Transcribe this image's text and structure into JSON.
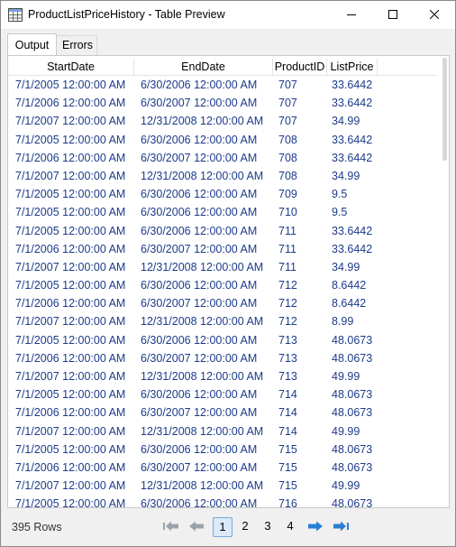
{
  "window": {
    "title": "ProductListPriceHistory - Table Preview"
  },
  "tabs": [
    {
      "label": "Output"
    },
    {
      "label": "Errors"
    }
  ],
  "table": {
    "columns": [
      "StartDate",
      "EndDate",
      "ProductID",
      "ListPrice"
    ],
    "rows": [
      [
        "7/1/2005 12:00:00 AM",
        "6/30/2006 12:00:00 AM",
        "707",
        "33.6442"
      ],
      [
        "7/1/2006 12:00:00 AM",
        "6/30/2007 12:00:00 AM",
        "707",
        "33.6442"
      ],
      [
        "7/1/2007 12:00:00 AM",
        "12/31/2008 12:00:00 AM",
        "707",
        "34.99"
      ],
      [
        "7/1/2005 12:00:00 AM",
        "6/30/2006 12:00:00 AM",
        "708",
        "33.6442"
      ],
      [
        "7/1/2006 12:00:00 AM",
        "6/30/2007 12:00:00 AM",
        "708",
        "33.6442"
      ],
      [
        "7/1/2007 12:00:00 AM",
        "12/31/2008 12:00:00 AM",
        "708",
        "34.99"
      ],
      [
        "7/1/2005 12:00:00 AM",
        "6/30/2006 12:00:00 AM",
        "709",
        "9.5"
      ],
      [
        "7/1/2005 12:00:00 AM",
        "6/30/2006 12:00:00 AM",
        "710",
        "9.5"
      ],
      [
        "7/1/2005 12:00:00 AM",
        "6/30/2006 12:00:00 AM",
        "711",
        "33.6442"
      ],
      [
        "7/1/2006 12:00:00 AM",
        "6/30/2007 12:00:00 AM",
        "711",
        "33.6442"
      ],
      [
        "7/1/2007 12:00:00 AM",
        "12/31/2008 12:00:00 AM",
        "711",
        "34.99"
      ],
      [
        "7/1/2005 12:00:00 AM",
        "6/30/2006 12:00:00 AM",
        "712",
        "8.6442"
      ],
      [
        "7/1/2006 12:00:00 AM",
        "6/30/2007 12:00:00 AM",
        "712",
        "8.6442"
      ],
      [
        "7/1/2007 12:00:00 AM",
        "12/31/2008 12:00:00 AM",
        "712",
        "8.99"
      ],
      [
        "7/1/2005 12:00:00 AM",
        "6/30/2006 12:00:00 AM",
        "713",
        "48.0673"
      ],
      [
        "7/1/2006 12:00:00 AM",
        "6/30/2007 12:00:00 AM",
        "713",
        "48.0673"
      ],
      [
        "7/1/2007 12:00:00 AM",
        "12/31/2008 12:00:00 AM",
        "713",
        "49.99"
      ],
      [
        "7/1/2005 12:00:00 AM",
        "6/30/2006 12:00:00 AM",
        "714",
        "48.0673"
      ],
      [
        "7/1/2006 12:00:00 AM",
        "6/30/2007 12:00:00 AM",
        "714",
        "48.0673"
      ],
      [
        "7/1/2007 12:00:00 AM",
        "12/31/2008 12:00:00 AM",
        "714",
        "49.99"
      ],
      [
        "7/1/2005 12:00:00 AM",
        "6/30/2006 12:00:00 AM",
        "715",
        "48.0673"
      ],
      [
        "7/1/2006 12:00:00 AM",
        "6/30/2007 12:00:00 AM",
        "715",
        "48.0673"
      ],
      [
        "7/1/2007 12:00:00 AM",
        "12/31/2008 12:00:00 AM",
        "715",
        "49.99"
      ],
      [
        "7/1/2005 12:00:00 AM",
        "6/30/2006 12:00:00 AM",
        "716",
        "48.0673"
      ]
    ]
  },
  "footer": {
    "row_count": "395 Rows",
    "pages": [
      "1",
      "2",
      "3",
      "4"
    ],
    "current_page": "1"
  },
  "colors": {
    "cell_text": "#1c3b8a",
    "pager_arrow_disabled": "#9aa3ad",
    "pager_arrow_enabled": "#2a7fd4",
    "current_page_bg": "#dbe9f8"
  },
  "icons": {
    "title": "table-icon",
    "minimize": "minimize-icon",
    "maximize": "maximize-icon",
    "close": "close-icon",
    "first": "first-page-icon",
    "prev": "previous-page-icon",
    "next": "next-page-icon",
    "last": "last-page-icon"
  }
}
